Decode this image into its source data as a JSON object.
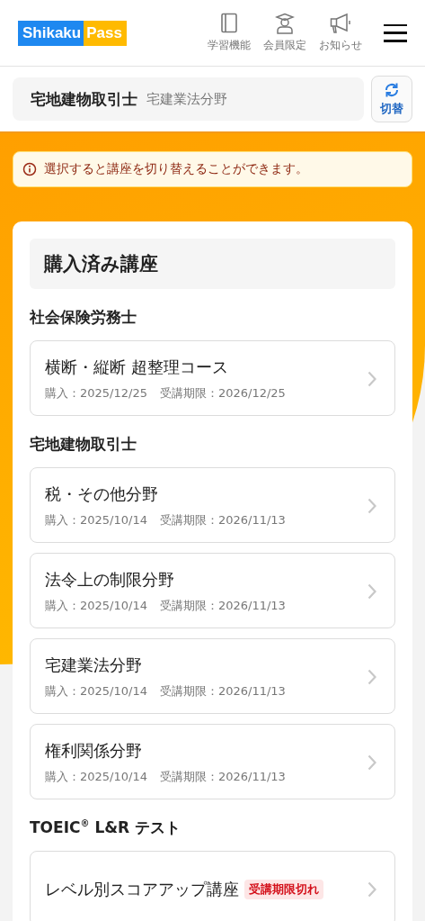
{
  "header": {
    "logo": [
      "Shikaku",
      "Pass"
    ],
    "nav": [
      {
        "kind": "book",
        "label": "学習機能"
      },
      {
        "kind": "graduate",
        "label": "会員限定"
      },
      {
        "kind": "megaphone",
        "label": "お知らせ"
      }
    ]
  },
  "current_course": {
    "qualification": "宅地建物取引士",
    "course": "宅建業法分野",
    "switch_label": "切替"
  },
  "notice": "選択すると講座を切り替えることができます。",
  "purchased": {
    "title": "購入済み講座",
    "groups": [
      {
        "name": "社会保険労務士",
        "courses": [
          {
            "title": "横断・縦断 超整理コース",
            "purchase": "購入：2025/12/25",
            "deadline": "受講期限：2026/12/25"
          }
        ]
      },
      {
        "name": "宅地建物取引士",
        "courses": [
          {
            "title": "税・その他分野",
            "purchase": "購入：2025/10/14",
            "deadline": "受講期限：2026/11/13"
          },
          {
            "title": "法令上の制限分野",
            "purchase": "購入：2025/10/14",
            "deadline": "受講期限：2026/11/13"
          },
          {
            "title": "宅建業法分野",
            "purchase": "購入：2025/10/14",
            "deadline": "受講期限：2026/11/13"
          },
          {
            "title": "権利関係分野",
            "purchase": "購入：2025/10/14",
            "deadline": "受講期限：2026/11/13"
          }
        ]
      },
      {
        "name": "TOEIC$^{®}$ L&R テスト",
        "courses": [
          {
            "title": "レベル別スコアアップ講座",
            "badge": "受講期限切れ"
          }
        ]
      }
    ]
  }
}
